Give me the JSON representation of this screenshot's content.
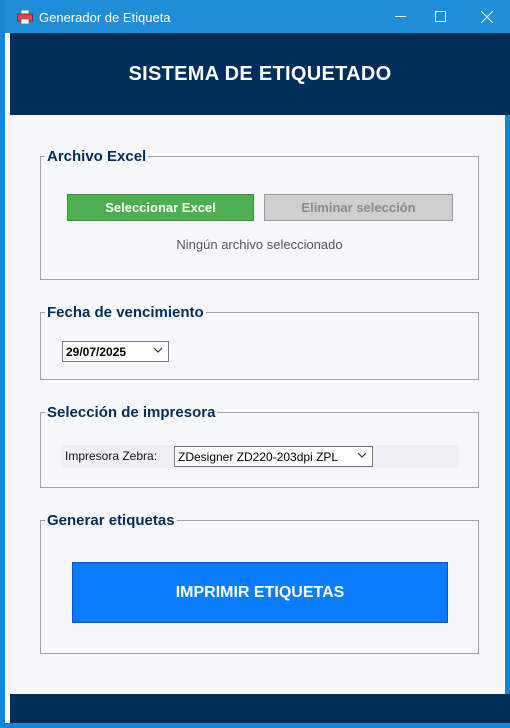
{
  "window": {
    "title": "Generador de Etiqueta"
  },
  "header": {
    "title": "SISTEMA DE ETIQUETADO"
  },
  "excel_section": {
    "label": "Archivo Excel",
    "select_button": "Seleccionar Excel",
    "clear_button": "Eliminar selección",
    "status": "Ningún archivo seleccionado"
  },
  "expiry_section": {
    "label": "Fecha de vencimiento",
    "date_value": "29/07/2025"
  },
  "printer_section": {
    "label": "Selección de impresora",
    "printer_label": "Impresora Zebra:",
    "printer_value": "ZDesigner ZD220-203dpi ZPL"
  },
  "generate_section": {
    "label": "Generar etiquetas",
    "print_button": "IMPRIMIR ETIQUETAS"
  },
  "colors": {
    "header": "#002e5a",
    "titlebar": "#1f8dd7",
    "green_button": "#4caf50",
    "print_button": "#0a7cff"
  },
  "icons": [
    "printer-app-icon",
    "minimize-icon",
    "maximize-icon",
    "close-icon",
    "chevron-down-icon"
  ]
}
